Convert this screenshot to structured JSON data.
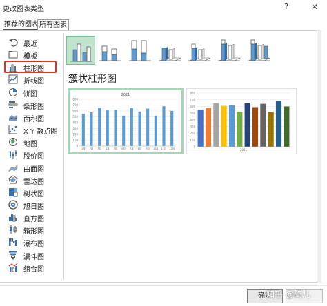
{
  "dialog": {
    "title": "更改图表类型",
    "help": "?",
    "close": "✕"
  },
  "tabs": [
    {
      "label": "推荐的图表"
    },
    {
      "label": "所有图表"
    }
  ],
  "sidebar": {
    "items": [
      {
        "label": "最近",
        "icon": "undo-icon"
      },
      {
        "label": "模板",
        "icon": "folder-icon"
      },
      {
        "label": "柱形图",
        "icon": "column-chart-icon",
        "selected": true
      },
      {
        "label": "折线图",
        "icon": "line-chart-icon"
      },
      {
        "label": "饼图",
        "icon": "pie-chart-icon"
      },
      {
        "label": "条形图",
        "icon": "bar-chart-icon"
      },
      {
        "label": "面积图",
        "icon": "area-chart-icon"
      },
      {
        "label": "X Y 散点图",
        "icon": "scatter-chart-icon"
      },
      {
        "label": "地图",
        "icon": "map-chart-icon"
      },
      {
        "label": "股价图",
        "icon": "stock-chart-icon"
      },
      {
        "label": "曲面图",
        "icon": "surface-chart-icon"
      },
      {
        "label": "雷达图",
        "icon": "radar-chart-icon"
      },
      {
        "label": "树状图",
        "icon": "treemap-chart-icon"
      },
      {
        "label": "旭日图",
        "icon": "sunburst-chart-icon"
      },
      {
        "label": "直方图",
        "icon": "histogram-chart-icon"
      },
      {
        "label": "箱形图",
        "icon": "box-whisker-chart-icon"
      },
      {
        "label": "瀑布图",
        "icon": "waterfall-chart-icon"
      },
      {
        "label": "漏斗图",
        "icon": "funnel-chart-icon"
      },
      {
        "label": "组合图",
        "icon": "combo-chart-icon"
      }
    ]
  },
  "subtypes": {
    "selected_index": 0,
    "items": [
      {
        "icon": "clustered-column-icon"
      },
      {
        "icon": "stacked-column-icon"
      },
      {
        "icon": "100-stacked-column-icon"
      },
      {
        "icon": "3d-clustered-column-icon"
      },
      {
        "icon": "3d-stacked-column-icon"
      },
      {
        "icon": "3d-100-stacked-column-icon"
      },
      {
        "icon": "3d-column-icon"
      }
    ],
    "title": "簇状柱形图"
  },
  "chart_data": [
    {
      "type": "bar",
      "title": "2021",
      "categories": [
        "1月",
        "2月",
        "3月",
        "4月",
        "5月",
        "6月",
        "7月",
        "8月",
        "9月",
        "10月",
        "11月",
        "12月"
      ],
      "values": [
        550,
        580,
        650,
        610,
        620,
        520,
        650,
        590,
        640,
        520,
        680,
        600
      ],
      "yticks": [
        "0",
        "100",
        "200",
        "300",
        "400",
        "500",
        "600",
        "700",
        "800"
      ],
      "ylim": [
        0,
        800
      ],
      "grid": true,
      "bar_color": "#5b9bd5"
    },
    {
      "type": "bar",
      "title": "",
      "xlabel": "2021",
      "categories": [
        "1",
        "2",
        "3",
        "4",
        "5",
        "6",
        "7",
        "8",
        "9",
        "10",
        "11",
        "12"
      ],
      "values": [
        550,
        580,
        650,
        610,
        620,
        520,
        650,
        590,
        640,
        520,
        680,
        600
      ],
      "yticks": [
        "0",
        "100",
        "200",
        "300",
        "400",
        "500",
        "600",
        "700",
        "800"
      ],
      "ylim": [
        0,
        800
      ],
      "grid": true,
      "colors": [
        "#4472c4",
        "#ed7d31",
        "#a5a5a5",
        "#ffc000",
        "#5b9bd5",
        "#70ad47",
        "#264478",
        "#9e480e",
        "#636363",
        "#997300",
        "#255e91",
        "#43682b"
      ]
    }
  ],
  "footer": {
    "ok_label": "确定",
    "cancel_label": "取消",
    "watermark": "知乎 @简儿"
  }
}
